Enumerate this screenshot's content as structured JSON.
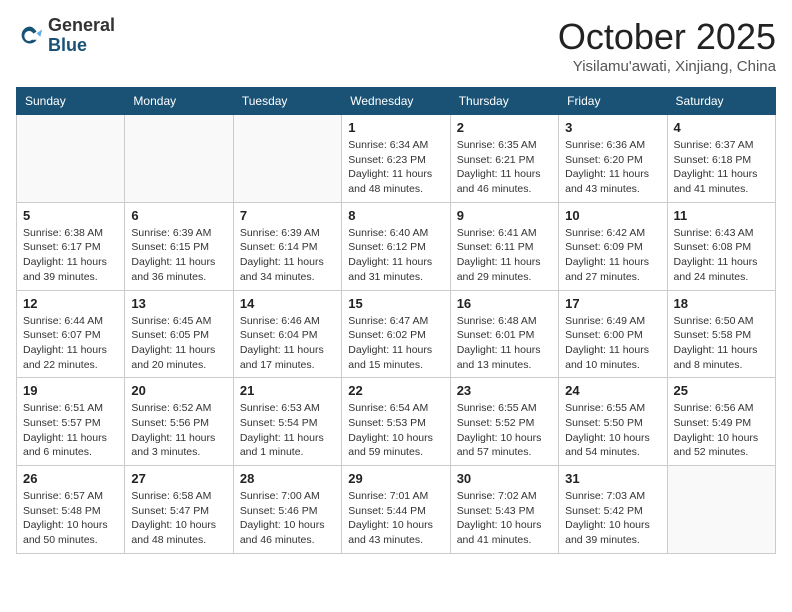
{
  "header": {
    "logo_general": "General",
    "logo_blue": "Blue",
    "month_title": "October 2025",
    "location": "Yisilamu'awati, Xinjiang, China"
  },
  "days_of_week": [
    "Sunday",
    "Monday",
    "Tuesday",
    "Wednesday",
    "Thursday",
    "Friday",
    "Saturday"
  ],
  "weeks": [
    [
      {
        "day": "",
        "info": ""
      },
      {
        "day": "",
        "info": ""
      },
      {
        "day": "",
        "info": ""
      },
      {
        "day": "1",
        "info": "Sunrise: 6:34 AM\nSunset: 6:23 PM\nDaylight: 11 hours\nand 48 minutes."
      },
      {
        "day": "2",
        "info": "Sunrise: 6:35 AM\nSunset: 6:21 PM\nDaylight: 11 hours\nand 46 minutes."
      },
      {
        "day": "3",
        "info": "Sunrise: 6:36 AM\nSunset: 6:20 PM\nDaylight: 11 hours\nand 43 minutes."
      },
      {
        "day": "4",
        "info": "Sunrise: 6:37 AM\nSunset: 6:18 PM\nDaylight: 11 hours\nand 41 minutes."
      }
    ],
    [
      {
        "day": "5",
        "info": "Sunrise: 6:38 AM\nSunset: 6:17 PM\nDaylight: 11 hours\nand 39 minutes."
      },
      {
        "day": "6",
        "info": "Sunrise: 6:39 AM\nSunset: 6:15 PM\nDaylight: 11 hours\nand 36 minutes."
      },
      {
        "day": "7",
        "info": "Sunrise: 6:39 AM\nSunset: 6:14 PM\nDaylight: 11 hours\nand 34 minutes."
      },
      {
        "day": "8",
        "info": "Sunrise: 6:40 AM\nSunset: 6:12 PM\nDaylight: 11 hours\nand 31 minutes."
      },
      {
        "day": "9",
        "info": "Sunrise: 6:41 AM\nSunset: 6:11 PM\nDaylight: 11 hours\nand 29 minutes."
      },
      {
        "day": "10",
        "info": "Sunrise: 6:42 AM\nSunset: 6:09 PM\nDaylight: 11 hours\nand 27 minutes."
      },
      {
        "day": "11",
        "info": "Sunrise: 6:43 AM\nSunset: 6:08 PM\nDaylight: 11 hours\nand 24 minutes."
      }
    ],
    [
      {
        "day": "12",
        "info": "Sunrise: 6:44 AM\nSunset: 6:07 PM\nDaylight: 11 hours\nand 22 minutes."
      },
      {
        "day": "13",
        "info": "Sunrise: 6:45 AM\nSunset: 6:05 PM\nDaylight: 11 hours\nand 20 minutes."
      },
      {
        "day": "14",
        "info": "Sunrise: 6:46 AM\nSunset: 6:04 PM\nDaylight: 11 hours\nand 17 minutes."
      },
      {
        "day": "15",
        "info": "Sunrise: 6:47 AM\nSunset: 6:02 PM\nDaylight: 11 hours\nand 15 minutes."
      },
      {
        "day": "16",
        "info": "Sunrise: 6:48 AM\nSunset: 6:01 PM\nDaylight: 11 hours\nand 13 minutes."
      },
      {
        "day": "17",
        "info": "Sunrise: 6:49 AM\nSunset: 6:00 PM\nDaylight: 11 hours\nand 10 minutes."
      },
      {
        "day": "18",
        "info": "Sunrise: 6:50 AM\nSunset: 5:58 PM\nDaylight: 11 hours\nand 8 minutes."
      }
    ],
    [
      {
        "day": "19",
        "info": "Sunrise: 6:51 AM\nSunset: 5:57 PM\nDaylight: 11 hours\nand 6 minutes."
      },
      {
        "day": "20",
        "info": "Sunrise: 6:52 AM\nSunset: 5:56 PM\nDaylight: 11 hours\nand 3 minutes."
      },
      {
        "day": "21",
        "info": "Sunrise: 6:53 AM\nSunset: 5:54 PM\nDaylight: 11 hours\nand 1 minute."
      },
      {
        "day": "22",
        "info": "Sunrise: 6:54 AM\nSunset: 5:53 PM\nDaylight: 10 hours\nand 59 minutes."
      },
      {
        "day": "23",
        "info": "Sunrise: 6:55 AM\nSunset: 5:52 PM\nDaylight: 10 hours\nand 57 minutes."
      },
      {
        "day": "24",
        "info": "Sunrise: 6:55 AM\nSunset: 5:50 PM\nDaylight: 10 hours\nand 54 minutes."
      },
      {
        "day": "25",
        "info": "Sunrise: 6:56 AM\nSunset: 5:49 PM\nDaylight: 10 hours\nand 52 minutes."
      }
    ],
    [
      {
        "day": "26",
        "info": "Sunrise: 6:57 AM\nSunset: 5:48 PM\nDaylight: 10 hours\nand 50 minutes."
      },
      {
        "day": "27",
        "info": "Sunrise: 6:58 AM\nSunset: 5:47 PM\nDaylight: 10 hours\nand 48 minutes."
      },
      {
        "day": "28",
        "info": "Sunrise: 7:00 AM\nSunset: 5:46 PM\nDaylight: 10 hours\nand 46 minutes."
      },
      {
        "day": "29",
        "info": "Sunrise: 7:01 AM\nSunset: 5:44 PM\nDaylight: 10 hours\nand 43 minutes."
      },
      {
        "day": "30",
        "info": "Sunrise: 7:02 AM\nSunset: 5:43 PM\nDaylight: 10 hours\nand 41 minutes."
      },
      {
        "day": "31",
        "info": "Sunrise: 7:03 AM\nSunset: 5:42 PM\nDaylight: 10 hours\nand 39 minutes."
      },
      {
        "day": "",
        "info": ""
      }
    ]
  ]
}
